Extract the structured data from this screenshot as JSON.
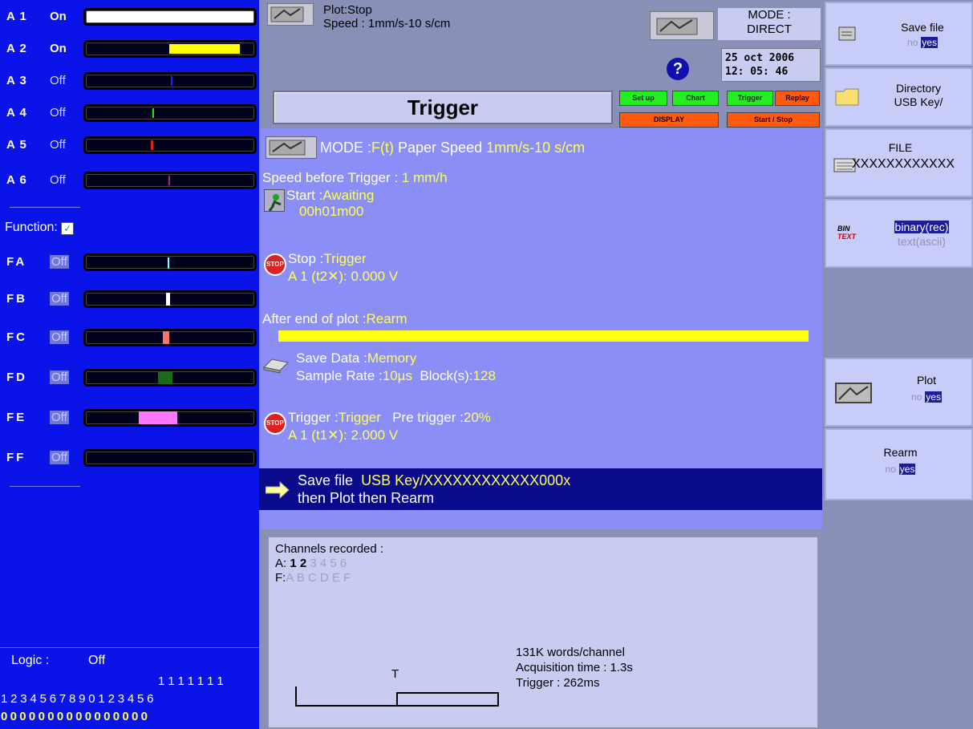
{
  "channels_a": [
    {
      "name": "A 1",
      "state": "On"
    },
    {
      "name": "A 2",
      "state": "On"
    },
    {
      "name": "A 3",
      "state": "Off"
    },
    {
      "name": "A 4",
      "state": "Off"
    },
    {
      "name": "A 5",
      "state": "Off"
    },
    {
      "name": "A 6",
      "state": "Off"
    }
  ],
  "function_label": "Function:",
  "channels_f": [
    {
      "name": "FA",
      "state": "Off"
    },
    {
      "name": "FB",
      "state": "Off"
    },
    {
      "name": "FC",
      "state": "Off"
    },
    {
      "name": "FD",
      "state": "Off"
    },
    {
      "name": "FE",
      "state": "Off"
    },
    {
      "name": "FF",
      "state": "Off"
    }
  ],
  "logic": {
    "label": "Logic :",
    "state": "Off",
    "tens": "1111111",
    "units": "1234567890123456",
    "values": "0000000000000000"
  },
  "plot_status": {
    "line1": "Plot:Stop",
    "line2": "Speed : 1mm/s-10 s/cm"
  },
  "mode_box": {
    "line1": "MODE :",
    "line2": "DIRECT"
  },
  "date": "25 oct 2006",
  "time": "12: 05: 46",
  "help_icon": "?",
  "page_title": "Trigger",
  "tabs": {
    "setup": "Set up",
    "chart": "Chart",
    "trigger": "Trigger",
    "replay": "Replay",
    "display": "DISPLAY",
    "start_stop": "Start / Stop"
  },
  "mode_line": {
    "label": "MODE :",
    "value": "F(t)",
    "paper_label": "Paper Speed",
    "paper_value": "1mm/s-10 s/cm"
  },
  "speed_before": {
    "label": "Speed before Trigger :",
    "value": "1 mm/h"
  },
  "start": {
    "label": "Start :",
    "value": "Awaiting",
    "time": "00h01m00"
  },
  "stop": {
    "label": "Stop :",
    "value": "Trigger",
    "detail": "A 1 (t2✕):  0.000 V"
  },
  "after_end": {
    "label": "After end of plot :",
    "value": "Rearm"
  },
  "save_data": {
    "label": "Save Data :",
    "value": "Memory",
    "rate_label": "Sample Rate :",
    "rate_value": "10µs",
    "block_label": "Block(s):",
    "block_value": "128"
  },
  "trigger": {
    "label": "Trigger :",
    "value": "Trigger",
    "pre_label": "Pre trigger :",
    "pre_value": "20%",
    "detail": "A 1 (t1✕):  2.000 V"
  },
  "save_file_banner": {
    "line1_label": "Save file",
    "line1_value": "USB Key/XXXXXXXXXXXX000x",
    "line2": "then Plot then Rearm"
  },
  "channels_recorded": {
    "title": "Channels recorded :",
    "a_prefix": "A:",
    "a_active": "1 2",
    "a_inactive": "3 4 5 6",
    "f_prefix": "F:",
    "f_inactive": "A B C D E F"
  },
  "acq_info": {
    "words": "131K words/channel",
    "acq_time": "Acquisition time : 1.3s",
    "trigger": "Trigger : 262ms",
    "marker": "T"
  },
  "right_buttons": {
    "save_file": {
      "title": "Save file",
      "no": "no",
      "yes": "yes"
    },
    "directory": {
      "line1": "Directory",
      "line2": "USB Key/"
    },
    "file": {
      "title": "FILE",
      "value": "XXXXXXXXXXXX"
    },
    "format": {
      "bin": "BIN",
      "text": "TEXT",
      "binary": "binary(rec)",
      "ascii": "text(ascii)"
    },
    "plot": {
      "title": "Plot",
      "no": "no",
      "yes": "yes"
    },
    "rearm": {
      "title": "Rearm",
      "no": "no",
      "yes": "yes"
    }
  },
  "colors": {
    "left_bg": "#0a14e8",
    "mid_bg": "#8c8ef8",
    "value_yellow": "#ffff55",
    "banner": "#0a0a8c"
  }
}
